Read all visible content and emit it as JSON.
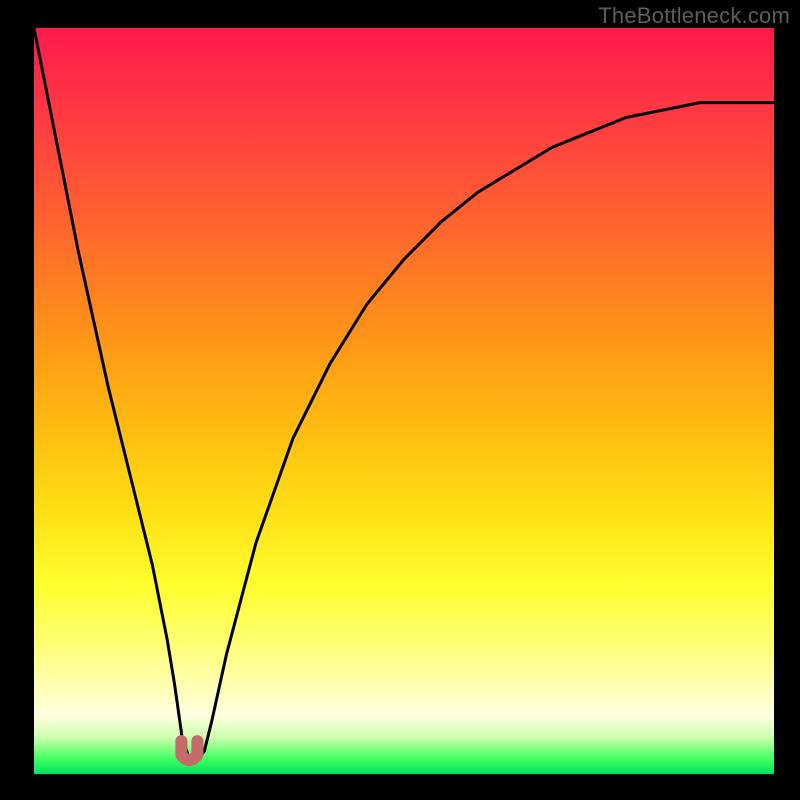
{
  "watermark": "TheBottleneck.com",
  "colors": {
    "frame": "#000000",
    "gradient_top": "#ff1a4d",
    "gradient_bottom": "#00e060",
    "curve": "#000000",
    "marker": "#c66a6a"
  },
  "chart_data": {
    "type": "line",
    "title": "",
    "xlabel": "",
    "ylabel": "",
    "xlim": [
      0,
      100
    ],
    "ylim": [
      0,
      100
    ],
    "series": [
      {
        "name": "bottleneck-curve",
        "x": [
          0,
          2,
          4,
          6,
          8,
          10,
          12,
          14,
          16,
          18,
          19,
          20,
          21,
          22,
          23,
          24,
          26,
          30,
          35,
          40,
          45,
          50,
          55,
          60,
          65,
          70,
          75,
          80,
          85,
          90,
          95,
          100
        ],
        "values": [
          100,
          90,
          80,
          70,
          61,
          52,
          44,
          36,
          28,
          18,
          12,
          5,
          2,
          2,
          3,
          7,
          16,
          31,
          45,
          55,
          63,
          69,
          74,
          78,
          81,
          84,
          86,
          88,
          89,
          90,
          90,
          90
        ]
      }
    ],
    "marker": {
      "name": "optimal-point",
      "x": 21,
      "y": 2,
      "shape": "u"
    }
  }
}
